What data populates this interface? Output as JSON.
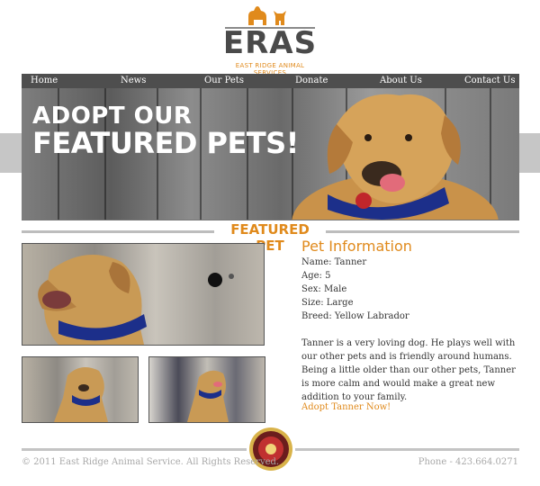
{
  "logo": {
    "wordmark": "ERAS",
    "tagline": "EAST RIDGE ANIMAL SERVICES",
    "color_orange": "#e08a1c"
  },
  "nav": {
    "items": [
      {
        "label": "Home"
      },
      {
        "label": "News"
      },
      {
        "label": "Our Pets"
      },
      {
        "label": "Donate"
      },
      {
        "label": "About Us"
      },
      {
        "label": "Contact Us"
      }
    ]
  },
  "hero": {
    "line1": "ADOPT OUR",
    "line2": "FEATURED PETS!"
  },
  "featured": {
    "heading": "FEATURED PET"
  },
  "pet_info": {
    "title": "Pet Information",
    "name": "Name: Tanner",
    "age": "Age: 5",
    "sex": "Sex: Male",
    "size": "Size: Large",
    "breed": "Breed: Yellow Labrador",
    "description": "Tanner is a very loving dog. He plays well with our other pets and is friendly around humans. Being a little older than our other pets, Tanner is more calm and would make a great new addition to your family.",
    "adopt_link": "Adopt Tanner Now!"
  },
  "footer": {
    "copyright": "© 2011 East Ridge Animal Service. All Rights Reserved.",
    "phone": "Phone - 423.664.0271"
  }
}
